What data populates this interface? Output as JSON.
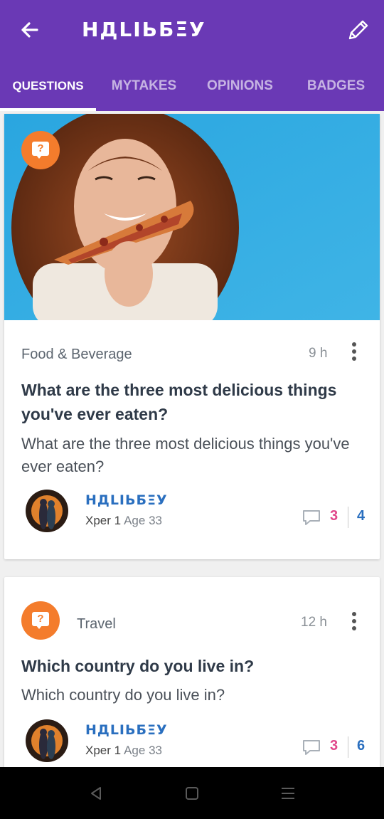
{
  "app_bar": {
    "title": "НДLIЬБΞУ",
    "back_icon": "arrow-left-icon",
    "edit_icon": "pencil-icon",
    "color": "#6a39b5"
  },
  "tabs": [
    {
      "label": "QUESTIONS",
      "active": true
    },
    {
      "label": "MYTAKES",
      "active": false
    },
    {
      "label": "OPINIONS",
      "active": false
    },
    {
      "label": "BADGES",
      "active": false
    }
  ],
  "posts": [
    {
      "category": "Food & Beverage",
      "time": "9 h",
      "title": "What are the three most delicious things you've ever eaten?",
      "body": "What are the three most delicious things you've ever eaten?",
      "author": "НДLIЬБΞУ",
      "level": "Xper 1",
      "age": "Age 33",
      "comments": "3",
      "opinions": "4",
      "has_image": true
    },
    {
      "category": "Travel",
      "time": "12 h",
      "title": "Which country do you live in?",
      "body": "Which country do you live in?",
      "author": "НДLIЬБΞУ",
      "level": "Xper 1",
      "age": "Age 33",
      "comments": "3",
      "opinions": "6",
      "has_image": false
    }
  ],
  "system_nav": {
    "back_icon": "triangle-back-icon",
    "home_icon": "square-home-icon",
    "menu_icon": "menu-lines-icon"
  }
}
